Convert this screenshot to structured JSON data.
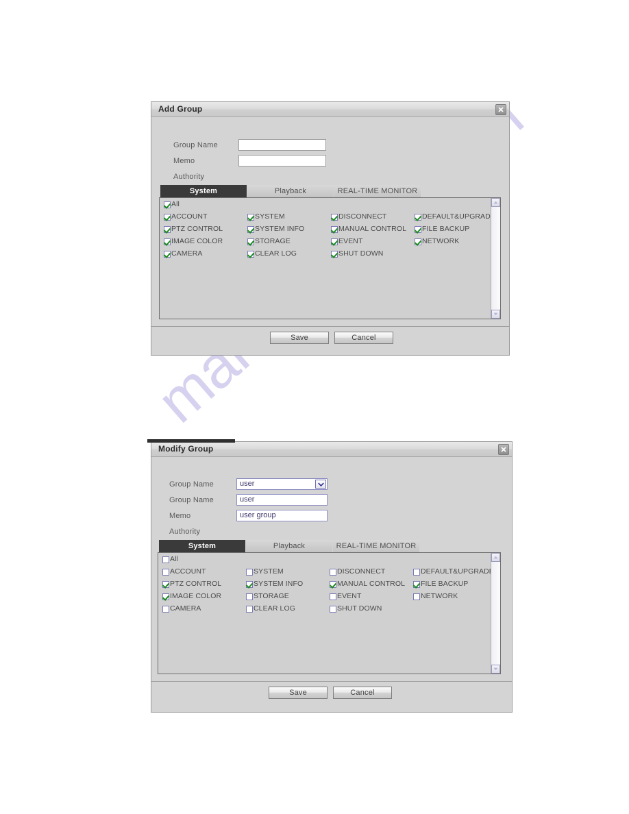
{
  "page": {
    "background": "#ffffff",
    "watermark_text": "manualshive.com",
    "watermark_color": "#968cd7"
  },
  "dialogs": [
    {
      "id": "add-group",
      "title": "Add Group",
      "close_icon": "close-icon",
      "fields": [
        {
          "label": "Group Name",
          "type": "text",
          "value": ""
        },
        {
          "label": "Memo",
          "type": "text",
          "value": ""
        }
      ],
      "authority_label": "Authority",
      "tabs": [
        {
          "label": "System",
          "active": true
        },
        {
          "label": "Playback",
          "active": false
        },
        {
          "label": "REAL-TIME MONITOR",
          "active": false
        }
      ],
      "select_all": {
        "label": "All",
        "checked": true
      },
      "permissions": [
        {
          "label": "ACCOUNT",
          "checked": true
        },
        {
          "label": "PTZ CONTROL",
          "checked": true
        },
        {
          "label": "IMAGE COLOR",
          "checked": true
        },
        {
          "label": "CAMERA",
          "checked": true
        },
        {
          "label": "SYSTEM",
          "checked": true
        },
        {
          "label": "SYSTEM INFO",
          "checked": true
        },
        {
          "label": "STORAGE",
          "checked": true
        },
        {
          "label": "CLEAR LOG",
          "checked": true
        },
        {
          "label": "DISCONNECT",
          "checked": true
        },
        {
          "label": "MANUAL CONTROL",
          "checked": true
        },
        {
          "label": "EVENT",
          "checked": true
        },
        {
          "label": "SHUT DOWN",
          "checked": true
        },
        {
          "label": "DEFAULT&UPGRADE",
          "checked": true
        },
        {
          "label": "FILE BACKUP",
          "checked": true
        },
        {
          "label": "NETWORK",
          "checked": true
        }
      ],
      "buttons": {
        "save": "Save",
        "cancel": "Cancel"
      }
    },
    {
      "id": "modify-group",
      "title": "Modify Group",
      "close_icon": "close-icon",
      "fields": [
        {
          "label": "Group Name",
          "type": "select",
          "value": "user"
        },
        {
          "label": "Group Name",
          "type": "text",
          "value": "user"
        },
        {
          "label": "Memo",
          "type": "text",
          "value": "user group"
        }
      ],
      "authority_label": "Authority",
      "tabs": [
        {
          "label": "System",
          "active": true
        },
        {
          "label": "Playback",
          "active": false
        },
        {
          "label": "REAL-TIME MONITOR",
          "active": false
        }
      ],
      "select_all": {
        "label": "All",
        "checked": false
      },
      "permissions": [
        {
          "label": "ACCOUNT",
          "checked": false
        },
        {
          "label": "PTZ CONTROL",
          "checked": true
        },
        {
          "label": "IMAGE COLOR",
          "checked": true
        },
        {
          "label": "CAMERA",
          "checked": false
        },
        {
          "label": "SYSTEM",
          "checked": false
        },
        {
          "label": "SYSTEM INFO",
          "checked": true
        },
        {
          "label": "STORAGE",
          "checked": false
        },
        {
          "label": "CLEAR LOG",
          "checked": false
        },
        {
          "label": "DISCONNECT",
          "checked": false
        },
        {
          "label": "MANUAL CONTROL",
          "checked": true
        },
        {
          "label": "EVENT",
          "checked": false
        },
        {
          "label": "SHUT DOWN",
          "checked": false
        },
        {
          "label": "DEFAULT&UPGRADE",
          "checked": false
        },
        {
          "label": "FILE BACKUP",
          "checked": true
        },
        {
          "label": "NETWORK",
          "checked": false
        }
      ],
      "buttons": {
        "save": "Save",
        "cancel": "Cancel"
      }
    }
  ],
  "layout": {
    "perm_columns_x": [
      6,
      128,
      250,
      372
    ],
    "perm_rows_y": [
      22,
      40,
      58,
      76
    ],
    "tab_widths": [
      127,
      127,
      127
    ]
  }
}
